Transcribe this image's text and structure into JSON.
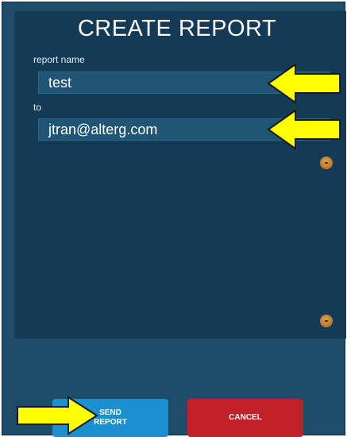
{
  "dialog": {
    "title": "CREATE REPORT",
    "report_name_label": "report name",
    "report_name_value": "test",
    "to_label": "to",
    "to_value": "jtran@alterg.com"
  },
  "actions": {
    "send_label": "SEND\nREPORT",
    "cancel_label": "CANCEL"
  },
  "colors": {
    "background": "#1e4d6a",
    "panel": "#143a55",
    "send_button": "#1b8fd0",
    "cancel_button": "#c0202a",
    "annotation_arrow": "#ffff00"
  },
  "icons": {
    "knob": "scroll-knob-icon",
    "arrow": "yellow-arrow-icon"
  }
}
